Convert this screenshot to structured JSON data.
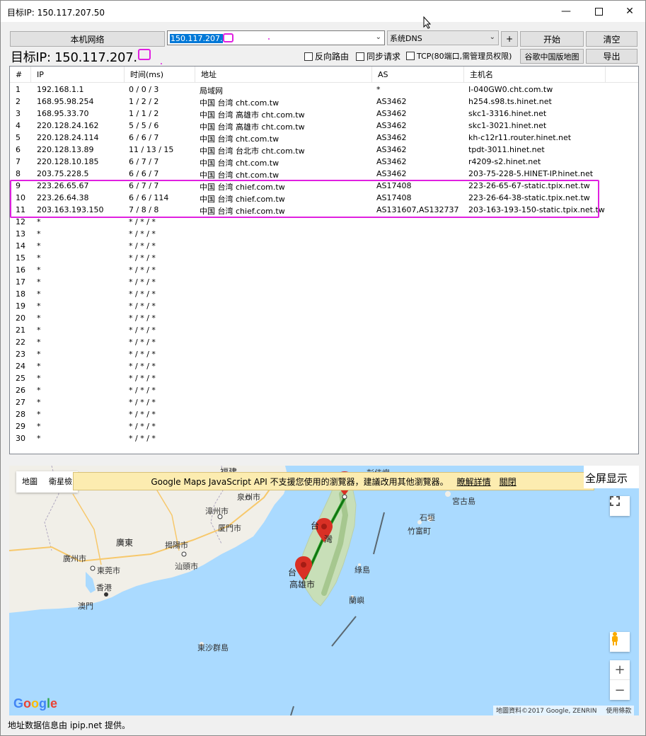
{
  "window": {
    "title": "目标IP: 150.117.207.50"
  },
  "toolbar": {
    "local_network_label": "本机网络",
    "target_input_value": "150.117.207.",
    "dns_select_value": "系统DNS",
    "plus_label": "+",
    "start_label": "开始",
    "clear_label": "清空",
    "target_display": "目标IP: 150.117.207.",
    "reverse_route_label": "反向路由",
    "sync_request_label": "同步请求",
    "tcp_label": "TCP(80端口,需管理员权限)",
    "google_china_map_label": "谷歌中国版地图",
    "export_label": "导出"
  },
  "table": {
    "headers": [
      "#",
      "IP",
      "时间(ms)",
      "地址",
      "AS",
      "主机名"
    ],
    "rows": [
      [
        "1",
        "192.168.1.1",
        "0 / 0 / 3",
        "局域网",
        "*",
        "I-040GW0.cht.com.tw"
      ],
      [
        "2",
        "168.95.98.254",
        "1 / 2 / 2",
        "中国 台湾 cht.com.tw",
        "AS3462",
        "h254.s98.ts.hinet.net"
      ],
      [
        "3",
        "168.95.33.70",
        "1 / 1 / 2",
        "中国 台湾 高雄市 cht.com.tw",
        "AS3462",
        "skc1-3316.hinet.net"
      ],
      [
        "4",
        "220.128.24.162",
        "5 / 5 / 6",
        "中国 台湾 高雄市 cht.com.tw",
        "AS3462",
        "skc1-3021.hinet.net"
      ],
      [
        "5",
        "220.128.24.114",
        "6 / 6 / 7",
        "中国 台湾 cht.com.tw",
        "AS3462",
        "kh-c12r11.router.hinet.net"
      ],
      [
        "6",
        "220.128.13.89",
        "11 / 13 / 15",
        "中国 台湾 台北市 cht.com.tw",
        "AS3462",
        "tpdt-3011.hinet.net"
      ],
      [
        "7",
        "220.128.10.185",
        "6 / 7 / 7",
        "中国 台湾 cht.com.tw",
        "AS3462",
        "r4209-s2.hinet.net"
      ],
      [
        "8",
        "203.75.228.5",
        "6 / 6 / 7",
        "中国 台湾 cht.com.tw",
        "AS3462",
        "203-75-228-5.HINET-IP.hinet.net"
      ],
      [
        "9",
        "223.26.65.67",
        "6 / 7 / 7",
        "中国 台湾 chief.com.tw",
        "AS17408",
        "223-26-65-67-static.tpix.net.tw"
      ],
      [
        "10",
        "223.26.64.38",
        "6 / 6 / 114",
        "中国 台湾 chief.com.tw",
        "AS17408",
        "223-26-64-38-static.tpix.net.tw"
      ],
      [
        "11",
        "203.163.193.150",
        "7 / 8 / 8",
        "中国 台湾 chief.com.tw",
        "AS131607,AS132737",
        "203-163-193-150-static.tpix.net.tw"
      ],
      [
        "12",
        "*",
        "* / * / *",
        "",
        "",
        ""
      ],
      [
        "13",
        "*",
        "* / * / *",
        "",
        "",
        ""
      ],
      [
        "14",
        "*",
        "* / * / *",
        "",
        "",
        ""
      ],
      [
        "15",
        "*",
        "* / * / *",
        "",
        "",
        ""
      ],
      [
        "16",
        "*",
        "* / * / *",
        "",
        "",
        ""
      ],
      [
        "17",
        "*",
        "* / * / *",
        "",
        "",
        ""
      ],
      [
        "18",
        "*",
        "* / * / *",
        "",
        "",
        ""
      ],
      [
        "19",
        "*",
        "* / * / *",
        "",
        "",
        ""
      ],
      [
        "20",
        "*",
        "* / * / *",
        "",
        "",
        ""
      ],
      [
        "21",
        "*",
        "* / * / *",
        "",
        "",
        ""
      ],
      [
        "22",
        "*",
        "* / * / *",
        "",
        "",
        ""
      ],
      [
        "23",
        "*",
        "* / * / *",
        "",
        "",
        ""
      ],
      [
        "24",
        "*",
        "* / * / *",
        "",
        "",
        ""
      ],
      [
        "25",
        "*",
        "* / * / *",
        "",
        "",
        ""
      ],
      [
        "26",
        "*",
        "* / * / *",
        "",
        "",
        ""
      ],
      [
        "27",
        "*",
        "* / * / *",
        "",
        "",
        ""
      ],
      [
        "28",
        "*",
        "* / * / *",
        "",
        "",
        ""
      ],
      [
        "29",
        "*",
        "* / * / *",
        "",
        "",
        ""
      ],
      [
        "30",
        "*",
        "* / * / *",
        "",
        "",
        ""
      ]
    ]
  },
  "map": {
    "type_map_label": "地圖",
    "type_satellite_label": "衛星檢",
    "warning_text": "Google Maps JavaScript API 不支援您使用的瀏覽器，建議改用其他瀏覽器。",
    "warning_link_details": "瞭解詳情",
    "warning_link_close": "關閉",
    "fullscreen_label": "全屏显示",
    "zoom_in": "+",
    "zoom_out": "−",
    "google_logo": "Google",
    "attribution": "地圖資料©2017 Google, ZENRIN",
    "terms": "使用條款",
    "labels": {
      "fujian": "福建",
      "quanzhou": "泉州市",
      "zhangzhou": "漳州市",
      "xiamen": "厦門市",
      "guangdong": "廣東",
      "jieyang": "揭陽市",
      "shantou": "汕頭市",
      "guangzhou": "廣州市",
      "dongguan": "東莞市",
      "hongkong": "香港",
      "macau": "澳門",
      "dongsha": "東沙群島",
      "taiwan_tai": "台",
      "taiwan_wan": "灣",
      "tainan_tai": "台",
      "kaohsiung": "高雄市",
      "pengjiayu": "彭佳嶼",
      "miyakojima": "宮古島",
      "ishigaki": "石垣",
      "taketomi": "竹富町",
      "ludao": "綠島",
      "lanyu": "蘭嶼"
    }
  },
  "status": {
    "text": "地址数据信息由 ipip.net 提供。"
  },
  "colors": {
    "highlight": "#e020e0",
    "selection": "#0078d7",
    "route_line": "#1e9a1e",
    "marker": "#d93025",
    "sea": "#aadaff"
  }
}
